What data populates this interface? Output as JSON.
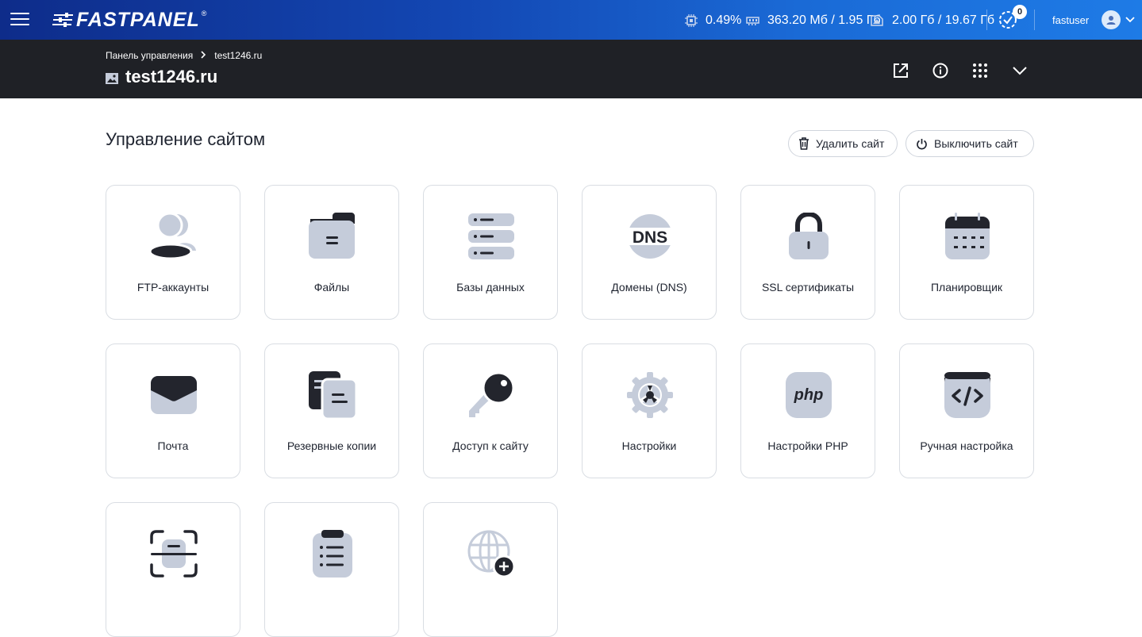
{
  "topbar": {
    "logo_text": "FASTPANEL",
    "logo_reg": "®",
    "cpu": "0.49%",
    "ram": "363.20 Мб / 1.95 Гб",
    "disk": "2.00 Гб / 19.67 Гб",
    "tasks_count": "0",
    "username": "fastuser",
    "icons": [
      "menu-icon",
      "cpu-icon",
      "ram-icon",
      "disk-icon",
      "timer-icon",
      "user-icon",
      "chevron-down-icon"
    ]
  },
  "subheader": {
    "breadcrumb": [
      "Панель управления",
      "test1246.ru"
    ],
    "site_title": "test1246.ru",
    "actions": [
      "external-link-icon",
      "info-icon",
      "apps-grid-icon",
      "chevron-down-icon"
    ]
  },
  "main": {
    "heading": "Управление сайтом",
    "delete_label": "Удалить сайт",
    "disable_label": "Выключить сайт",
    "tiles": [
      {
        "label": "FTP-аккаунты",
        "icon": "ftp-users-icon"
      },
      {
        "label": "Файлы",
        "icon": "folder-icon"
      },
      {
        "label": "Базы данных",
        "icon": "database-icon"
      },
      {
        "label": "Домены (DNS)",
        "icon": "dns-icon"
      },
      {
        "label": "SSL сертификаты",
        "icon": "lock-icon"
      },
      {
        "label": "Планировщик",
        "icon": "calendar-icon"
      },
      {
        "label": "Почта",
        "icon": "mail-icon"
      },
      {
        "label": "Резервные копии",
        "icon": "backup-icon"
      },
      {
        "label": "Доступ к сайту",
        "icon": "key-icon"
      },
      {
        "label": "Настройки",
        "icon": "gear-icon"
      },
      {
        "label": "Настройки PHP",
        "icon": "php-icon"
      },
      {
        "label": "Ручная настройка",
        "icon": "code-icon"
      },
      {
        "label": "",
        "icon": "scan-icon"
      },
      {
        "label": "",
        "icon": "clipboard-list-icon"
      },
      {
        "label": "",
        "icon": "globe-add-icon"
      }
    ]
  },
  "colors": {
    "accent": "#1a5fcc",
    "header_dark": "#1f2126",
    "icon_light": "#c5ccda",
    "icon_dark": "#23252d"
  }
}
